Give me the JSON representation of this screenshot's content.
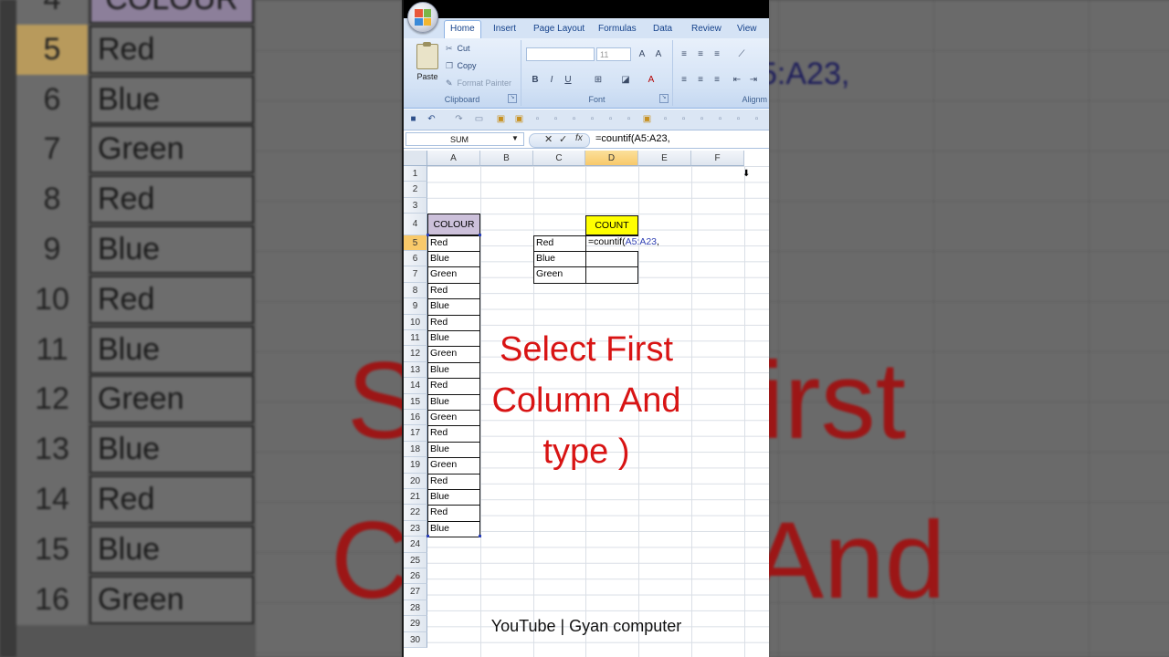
{
  "ribbon": {
    "tabs": [
      "Home",
      "Insert",
      "Page Layout",
      "Formulas",
      "Data",
      "Review",
      "View"
    ],
    "clipboard": {
      "paste": "Paste",
      "cut": "Cut",
      "copy": "Copy",
      "format_painter": "Format Painter",
      "label": "Clipboard"
    },
    "font": {
      "size": "11",
      "label": "Font"
    },
    "alignment": {
      "label": "Alignm"
    }
  },
  "formula_bar": {
    "name_box": "SUM",
    "formula": "=countif(A5:A23,"
  },
  "columns": [
    "A",
    "B",
    "C",
    "D",
    "E",
    "F"
  ],
  "rows": [
    "1",
    "2",
    "3",
    "4",
    "5",
    "6",
    "7",
    "8",
    "9",
    "10",
    "11",
    "12",
    "13",
    "14",
    "15",
    "16",
    "17",
    "18",
    "19",
    "20",
    "21",
    "22",
    "23",
    "24",
    "25",
    "26",
    "27",
    "28",
    "29",
    "30"
  ],
  "sheet": {
    "colour_header": "COLOUR",
    "colour_values": [
      "Red",
      "Blue",
      "Green",
      "Red",
      "Blue",
      "Red",
      "Blue",
      "Green",
      "Blue",
      "Red",
      "Blue",
      "Green",
      "Red",
      "Blue",
      "Green",
      "Red",
      "Blue",
      "Red",
      "Blue"
    ],
    "count_header": "COUNT",
    "criteria": [
      "Red",
      "Blue",
      "Green"
    ],
    "editing_prefix": "=countif(",
    "editing_ref": "A5:A23",
    "editing_suffix": ","
  },
  "overlay": {
    "lines": [
      "Select First",
      "Column And",
      "type  )"
    ],
    "credit": "YouTube | Gyan computer"
  },
  "background": {
    "left_rows": [
      "4",
      "5",
      "6",
      "7",
      "8",
      "9",
      "10",
      "11",
      "12",
      "13",
      "14",
      "15",
      "16"
    ],
    "left_cells": [
      "COLOUR",
      "Red",
      "Blue",
      "Green",
      "Red",
      "Blue",
      "Red",
      "Blue",
      "Green",
      "Blue",
      "Red",
      "Blue",
      "Green"
    ],
    "right_formula": "5:A23,",
    "right_big1": "irst",
    "right_big2": "And",
    "left_big1": "S",
    "left_big2": "C"
  },
  "colors": {
    "accent_red": "#d81414",
    "colour_header_bg": "#ccc0da",
    "count_header_bg": "#ffff00",
    "selected_header": "#f8c96a"
  }
}
